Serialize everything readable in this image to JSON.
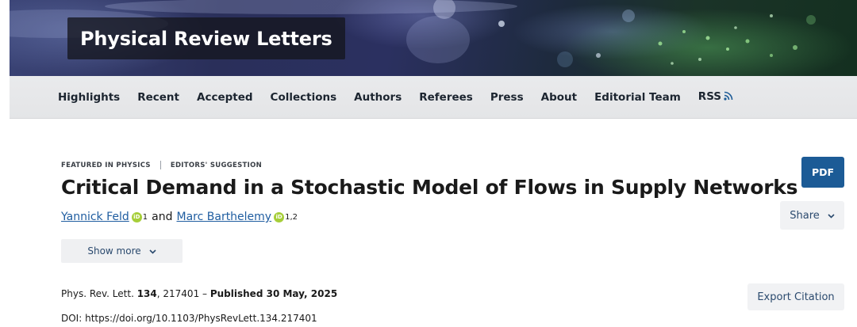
{
  "journal": {
    "title": "Physical Review Letters"
  },
  "nav": {
    "items": [
      {
        "label": "Highlights"
      },
      {
        "label": "Recent"
      },
      {
        "label": "Accepted"
      },
      {
        "label": "Collections"
      },
      {
        "label": "Authors"
      },
      {
        "label": "Referees"
      },
      {
        "label": "Press"
      },
      {
        "label": "About"
      },
      {
        "label": "Editorial Team"
      },
      {
        "label": "RSS"
      }
    ],
    "rss_icon": "rss-feed-icon"
  },
  "article": {
    "flags": [
      "FEATURED IN PHYSICS",
      "EDITORS' SUGGESTION"
    ],
    "title": "Critical Demand in a Stochastic Model of Flows in Supply Networks",
    "authors": [
      {
        "name": "Yannick Feld",
        "affiliation": "1",
        "orcid_icon": "orcid-icon"
      },
      {
        "name": "Marc Barthelemy",
        "affiliation": "1,2",
        "orcid_icon": "orcid-icon"
      }
    ],
    "and_text": "and",
    "show_more_label": "Show more",
    "citation": {
      "journal_abbrev": "Phys. Rev. Lett.",
      "volume": "134",
      "article_number": ", 217401 – ",
      "published": "Published 30 May, 2025"
    },
    "doi": "DOI: https://doi.org/10.1103/PhysRevLett.134.217401"
  },
  "actions": {
    "pdf_label": "PDF",
    "share_label": "Share",
    "export_label": "Export Citation"
  },
  "colors": {
    "accent": "#1c5b96",
    "link": "#1f5da0",
    "orcid": "#a6ce39",
    "nav_bg": "#e6e7e9"
  }
}
